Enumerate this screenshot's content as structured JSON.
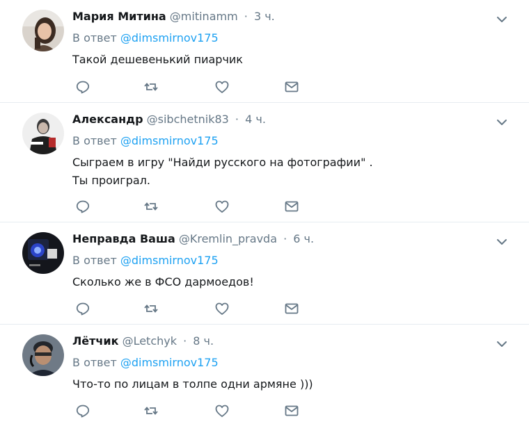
{
  "reply_prefix": "В ответ",
  "icons": {
    "reply": "reply-icon",
    "retweet": "retweet-icon",
    "like": "heart-icon",
    "dm": "envelope-icon",
    "menu": "chevron-down-icon"
  },
  "colors": {
    "mention": "#1da1f2",
    "secondary": "#657786",
    "icon": "#657786",
    "divider": "#e6ecf0"
  },
  "tweets": [
    {
      "name": "Мария Митина",
      "handle": "@mitinamm",
      "sep": "·",
      "time": "3 ч.",
      "reply_to": "@dimsmirnov175",
      "lines": [
        "Такой дешевенький пиарчик"
      ]
    },
    {
      "name": "Александр",
      "handle": "@sibchetnik83",
      "sep": "·",
      "time": "4 ч.",
      "reply_to": "@dimsmirnov175",
      "lines": [
        "Сыграем в игру \"Найди русского на фотографии\" .",
        "Ты проиграл."
      ]
    },
    {
      "name": "Неправда Ваша",
      "handle": "@Kremlin_pravda",
      "sep": "·",
      "time": "6 ч.",
      "reply_to": "@dimsmirnov175",
      "lines": [
        "Сколько же в ФСО дармоедов!"
      ]
    },
    {
      "name": "Лётчик",
      "handle": "@Letchyk",
      "sep": "·",
      "time": "8 ч.",
      "reply_to": "@dimsmirnov175",
      "lines": [
        "Что-то по лицам в толпе одни армяне )))"
      ]
    }
  ]
}
